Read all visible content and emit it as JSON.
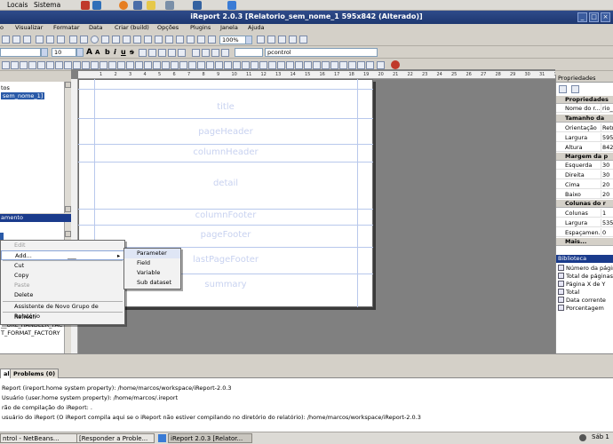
{
  "top_panel": {
    "menus": [
      "Locais",
      "Sistema"
    ]
  },
  "window": {
    "title": "iReport 2.0.3 [Relatorio_sem_nome_1 595x842 (Alterado)]"
  },
  "menubar": [
    "Visualizar",
    "Formatar",
    "Data",
    "Criar (build)",
    "Opções",
    "Plugins",
    "Janela",
    "Ajuda"
  ],
  "toolbar": {
    "zoom": "100%",
    "font_size": "10",
    "font_style": "A",
    "element_name": "pcontrol"
  },
  "ruler_labels": [
    "1",
    "2",
    "3",
    "4",
    "5",
    "6",
    "7",
    "8",
    "9",
    "10",
    "11",
    "12",
    "13",
    "14",
    "15",
    "16",
    "17",
    "18",
    "19",
    "20",
    "21",
    "22",
    "23",
    "24",
    "25",
    "26",
    "27",
    "28",
    "29",
    "30",
    "31",
    "32"
  ],
  "tree_top": {
    "item1": "tos",
    "item2": "sem_nome_1]"
  },
  "doc_struct": {
    "header": "amento",
    "item1": "__URL_HANDLER_FAC",
    "item2": "T_FORMAT_FACTORY"
  },
  "bands": [
    "title",
    "pageHeader",
    "columnHeader",
    "detail",
    "columnFooter",
    "pageFooter",
    "lastPageFooter",
    "summary"
  ],
  "context_menu": {
    "edit": "Edit",
    "add": "Add...",
    "add_shortcut": "___",
    "cut": "Cut",
    "copy": "Copy",
    "paste": "Paste",
    "delete": "Delete",
    "group": "Assistente de Novo Grupo de Relatório",
    "refresh": "Refresh"
  },
  "submenu": [
    "Parameter",
    "Field",
    "Variable",
    "Sub dataset"
  ],
  "properties": {
    "title": "Propriedades",
    "sections": {
      "props": "Propriedades",
      "size": "Tamanho da",
      "margin": "Margem da p",
      "columns": "Colunas do r",
      "more": "Mais..."
    },
    "rows": {
      "name": [
        "Nome do r...",
        "rio_"
      ],
      "orient": [
        "Orientação",
        "Retr"
      ],
      "width": [
        "Largura",
        "595"
      ],
      "height": [
        "Altura",
        "842"
      ],
      "left": [
        "Esquerda",
        "30"
      ],
      "right": [
        "Direita",
        "30"
      ],
      "top": [
        "Cima",
        "20"
      ],
      "bottom": [
        "Baixo",
        "20"
      ],
      "cols": [
        "Colunas",
        "1"
      ],
      "colw": [
        "Largura",
        "535"
      ],
      "spacing": [
        "Espaçamen...",
        "0"
      ]
    }
  },
  "library": {
    "title": "Biblioteca",
    "items": [
      "Número da página",
      "Total de páginas",
      "Página X de Y",
      "Total",
      "Data corrente",
      "Porcentagem"
    ]
  },
  "tabs": [
    "al",
    "Problems (0)"
  ],
  "output": [
    "Report (ireport.home system property): /home/marcos/workspace/iReport-2.0.3",
    "Usuário (user.home system property): /home/marcos/.ireport",
    "rão de compilação do iReport: .",
    "usuário do iReport (O iReport compila aqui se o iReport não estiver compilando no diretório do relatório): /home/marcos/workspace/iReport-2.0.3"
  ],
  "taskbar": {
    "t1": "ntrol - NetBeans...",
    "t2": "[Responder a Proble...",
    "t3": "iReport 2.0.3 [Relator...",
    "clock": "Sáb 1"
  }
}
